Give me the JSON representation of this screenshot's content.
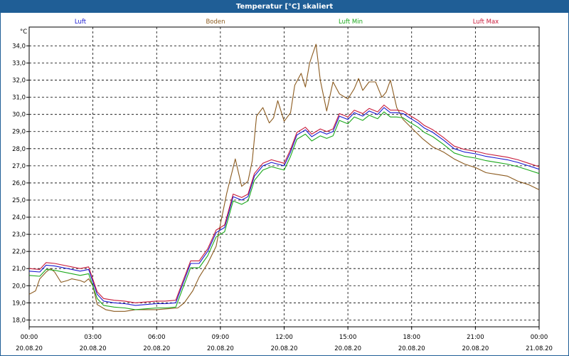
{
  "title": "Temperatur [°C] skaliert",
  "chart_data": {
    "type": "line",
    "title": "Temperatur [°C] skaliert",
    "ylabel": "°C",
    "ylim": [
      17.6,
      35.1
    ],
    "yticks": [
      "18,0",
      "19,0",
      "20,0",
      "21,0",
      "22,0",
      "23,0",
      "24,0",
      "25,0",
      "26,0",
      "27,0",
      "28,0",
      "29,0",
      "30,0",
      "31,0",
      "32,0",
      "33,0",
      "34,0"
    ],
    "xlim": [
      0,
      24
    ],
    "xticks": [
      {
        "time": "00:00",
        "date": "20.08.20"
      },
      {
        "time": "03:00",
        "date": "20.08.20"
      },
      {
        "time": "06:00",
        "date": "20.08.20"
      },
      {
        "time": "09:00",
        "date": "20.08.20"
      },
      {
        "time": "12:00",
        "date": "20.08.20"
      },
      {
        "time": "15:00",
        "date": "20.08.20"
      },
      {
        "time": "18:00",
        "date": "20.08.20"
      },
      {
        "time": "21:00",
        "date": "20.08.20"
      },
      {
        "time": "00:00",
        "date": "21.08.20"
      }
    ],
    "grid": true,
    "legend_position": "top",
    "series": [
      {
        "name": "Luft",
        "color": "#1a1ad0",
        "offset": 0,
        "x": [
          0,
          0.5,
          0.8,
          1.2,
          2.4,
          2.8,
          3.2,
          3.5,
          4,
          4.5,
          5,
          5.5,
          6,
          6.4,
          6.9,
          7.2,
          7.6,
          8,
          8.4,
          8.8,
          9.2,
          9.6,
          10,
          10.3,
          10.6,
          11,
          11.4,
          11.7,
          12,
          12.3,
          12.6,
          13,
          13.3,
          13.7,
          14,
          14.3,
          14.6,
          15,
          15.3,
          15.7,
          16,
          16.4,
          16.7,
          17,
          17.3,
          17.6,
          17.9,
          18.3,
          18.6,
          19,
          19.5,
          20,
          20.5,
          21,
          21.5,
          22,
          22.5,
          23,
          23.5,
          24
        ],
        "y": [
          20.85,
          20.8,
          21.2,
          21.15,
          20.85,
          20.95,
          19.5,
          19.1,
          19.0,
          18.95,
          18.85,
          18.9,
          18.95,
          18.95,
          19.0,
          20.0,
          21.3,
          21.3,
          22.0,
          23.1,
          23.4,
          25.2,
          25.0,
          25.2,
          26.4,
          27.0,
          27.2,
          27.1,
          27.0,
          27.8,
          28.8,
          29.1,
          28.7,
          29.0,
          28.85,
          29.0,
          29.9,
          29.7,
          30.1,
          29.9,
          30.2,
          30.0,
          30.4,
          30.1,
          30.1,
          30.05,
          29.8,
          29.5,
          29.2,
          28.95,
          28.5,
          28.0,
          27.8,
          27.7,
          27.55,
          27.45,
          27.35,
          27.2,
          27.0,
          26.8
        ]
      },
      {
        "name": "Boden",
        "color": "#8b5a1e",
        "offset": 0,
        "x": [
          0,
          0.3,
          0.5,
          0.8,
          1,
          1.2,
          1.5,
          1.8,
          2.0,
          2.4,
          2.6,
          2.8,
          3.0,
          3.2,
          3.6,
          4,
          4.5,
          5,
          5.5,
          6,
          6.5,
          7,
          7.3,
          7.7,
          8,
          8.4,
          8.8,
          9.0,
          9.3,
          9.7,
          10,
          10.3,
          10.5,
          10.7,
          11,
          11.3,
          11.5,
          11.7,
          12,
          12.3,
          12.5,
          12.8,
          13,
          13.2,
          13.5,
          13.7,
          14,
          14.3,
          14.6,
          15,
          15.3,
          15.5,
          15.7,
          16,
          16.3,
          16.6,
          16.8,
          17,
          17.3,
          17.6,
          18,
          18.5,
          19,
          19.5,
          20,
          20.5,
          21,
          21.5,
          22,
          22.5,
          23,
          23.5,
          24
        ],
        "y": [
          19.5,
          19.7,
          20.4,
          20.8,
          21.0,
          20.8,
          20.2,
          20.3,
          20.4,
          20.3,
          20.2,
          20.4,
          20.0,
          18.9,
          18.6,
          18.5,
          18.5,
          18.6,
          18.6,
          18.6,
          18.65,
          18.7,
          19.0,
          19.7,
          20.5,
          21.3,
          22.3,
          23.6,
          25.4,
          27.4,
          25.8,
          26.1,
          27.3,
          29.9,
          30.4,
          29.5,
          29.8,
          30.8,
          29.6,
          30.1,
          31.7,
          32.4,
          31.6,
          33.0,
          34.1,
          32.0,
          30.2,
          31.9,
          31.2,
          30.9,
          31.5,
          32.1,
          31.4,
          31.9,
          31.9,
          31.0,
          31.3,
          32.0,
          30.4,
          29.7,
          29.2,
          28.6,
          28.1,
          27.8,
          27.4,
          27.1,
          26.9,
          26.6,
          26.5,
          26.4,
          26.1,
          25.9,
          25.6
        ]
      },
      {
        "name": "Luft Min",
        "color": "#1aa81a",
        "offset": -0.25,
        "x": [
          0,
          0.5,
          0.8,
          1.2,
          2.4,
          2.8,
          3.2,
          3.5,
          4,
          4.5,
          5,
          5.5,
          6,
          6.4,
          6.9,
          7.2,
          7.6,
          8,
          8.4,
          8.8,
          9.2,
          9.6,
          10,
          10.3,
          10.6,
          11,
          11.4,
          11.7,
          12,
          12.3,
          12.6,
          13,
          13.3,
          13.7,
          14,
          14.3,
          14.6,
          15,
          15.3,
          15.7,
          16,
          16.4,
          16.7,
          17,
          17.3,
          17.6,
          17.9,
          18.3,
          18.6,
          19,
          19.5,
          20,
          20.5,
          21,
          21.5,
          22,
          22.5,
          23,
          23.5,
          24
        ],
        "y": [
          20.85,
          20.8,
          21.2,
          21.15,
          20.85,
          20.95,
          19.5,
          19.1,
          19.0,
          18.95,
          18.85,
          18.9,
          18.95,
          18.95,
          19.0,
          20.0,
          21.3,
          21.3,
          22.0,
          23.1,
          23.4,
          25.2,
          25.0,
          25.2,
          26.4,
          27.0,
          27.2,
          27.1,
          27.0,
          27.8,
          28.8,
          29.1,
          28.7,
          29.0,
          28.85,
          29.0,
          29.9,
          29.7,
          30.1,
          29.9,
          30.2,
          30.0,
          30.4,
          30.1,
          30.1,
          30.05,
          29.8,
          29.5,
          29.2,
          28.95,
          28.5,
          28.0,
          27.8,
          27.7,
          27.55,
          27.45,
          27.35,
          27.2,
          27.0,
          26.8
        ]
      },
      {
        "name": "Luft Max",
        "color": "#c81a3a",
        "offset": 0.15,
        "x": [
          0,
          0.5,
          0.8,
          1.2,
          2.4,
          2.8,
          3.2,
          3.5,
          4,
          4.5,
          5,
          5.5,
          6,
          6.4,
          6.9,
          7.2,
          7.6,
          8,
          8.4,
          8.8,
          9.2,
          9.6,
          10,
          10.3,
          10.6,
          11,
          11.4,
          11.7,
          12,
          12.3,
          12.6,
          13,
          13.3,
          13.7,
          14,
          14.3,
          14.6,
          15,
          15.3,
          15.7,
          16,
          16.4,
          16.7,
          17,
          17.3,
          17.6,
          17.9,
          18.3,
          18.6,
          19,
          19.5,
          20,
          20.5,
          21,
          21.5,
          22,
          22.5,
          23,
          23.5,
          24
        ],
        "y": [
          20.85,
          20.8,
          21.2,
          21.15,
          20.85,
          20.95,
          19.5,
          19.1,
          19.0,
          18.95,
          18.85,
          18.9,
          18.95,
          18.95,
          19.0,
          20.0,
          21.3,
          21.3,
          22.0,
          23.1,
          23.4,
          25.2,
          25.0,
          25.2,
          26.4,
          27.0,
          27.2,
          27.1,
          27.0,
          27.8,
          28.8,
          29.1,
          28.7,
          29.0,
          28.85,
          29.0,
          29.9,
          29.7,
          30.1,
          29.9,
          30.2,
          30.0,
          30.4,
          30.1,
          30.1,
          30.05,
          29.8,
          29.5,
          29.2,
          28.95,
          28.5,
          28.0,
          27.8,
          27.7,
          27.55,
          27.45,
          27.35,
          27.2,
          27.0,
          26.8
        ]
      }
    ]
  }
}
